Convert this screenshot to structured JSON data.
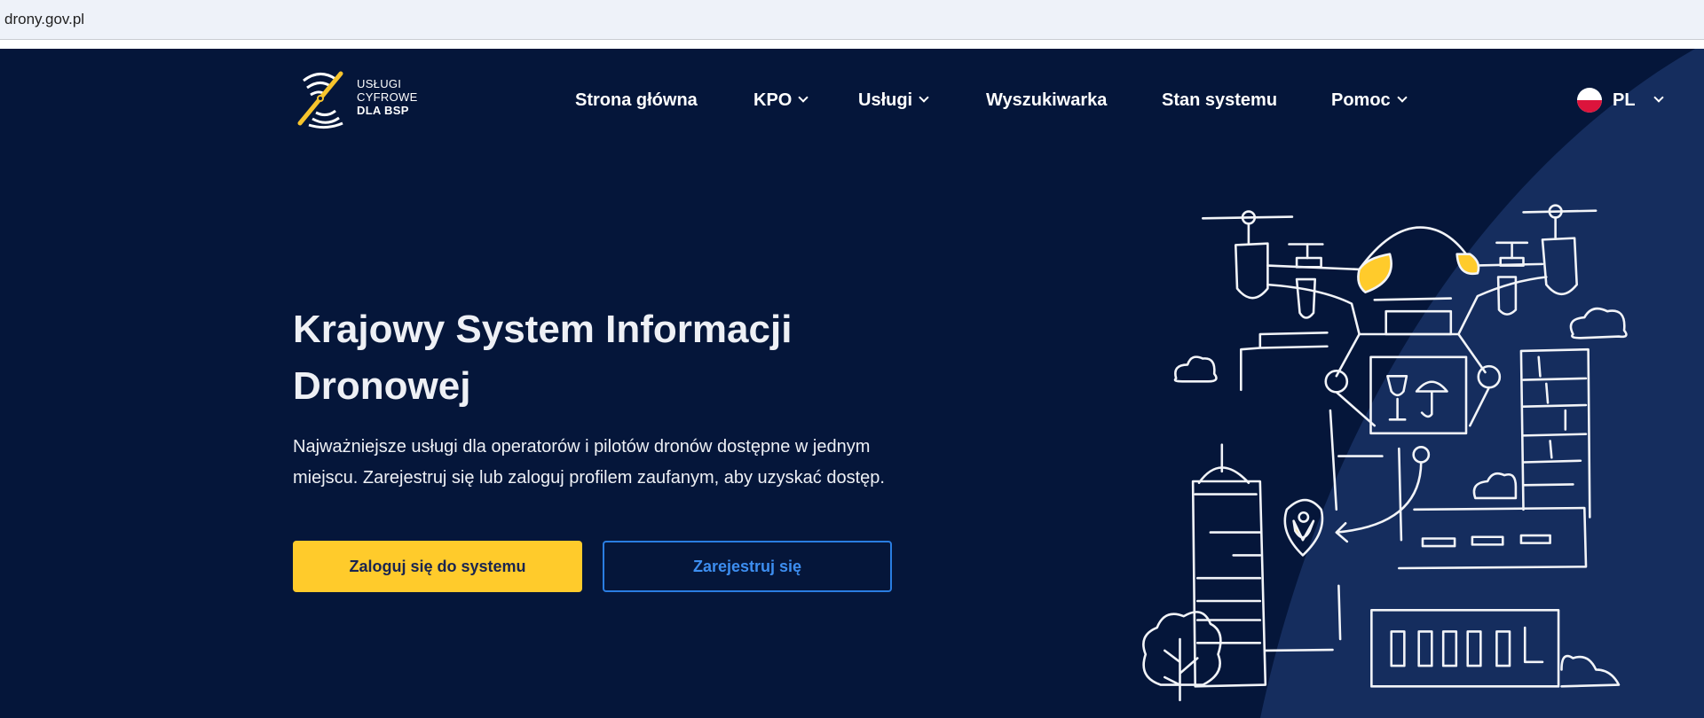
{
  "browser": {
    "url": "drony.gov.pl"
  },
  "logo": {
    "line1": "USŁUGI",
    "line2": "CYFROWE",
    "line3": "DLA BSP"
  },
  "nav": {
    "items": [
      {
        "label": "Strona główna",
        "dropdown": false
      },
      {
        "label": "KPO",
        "dropdown": true
      },
      {
        "label": "Usługi",
        "dropdown": true
      },
      {
        "label": "Wyszukiwarka",
        "dropdown": false
      },
      {
        "label": "Stan systemu",
        "dropdown": false
      },
      {
        "label": "Pomoc",
        "dropdown": true
      }
    ],
    "language": "PL"
  },
  "hero": {
    "title": "Krajowy System Informacji Dronowej",
    "description": "Najważniejsze usługi dla operatorów i pilotów dronów dostępne w jednym miejscu. Zarejestruj się lub zaloguj profilem zaufanym, aby uzyskać dostęp.",
    "login_label": "Zaloguj się do systemu",
    "register_label": "Zarejestruj się"
  },
  "colors": {
    "background": "#05163a",
    "accent": "#ffcb2b",
    "secondary": "#2a7de1"
  }
}
